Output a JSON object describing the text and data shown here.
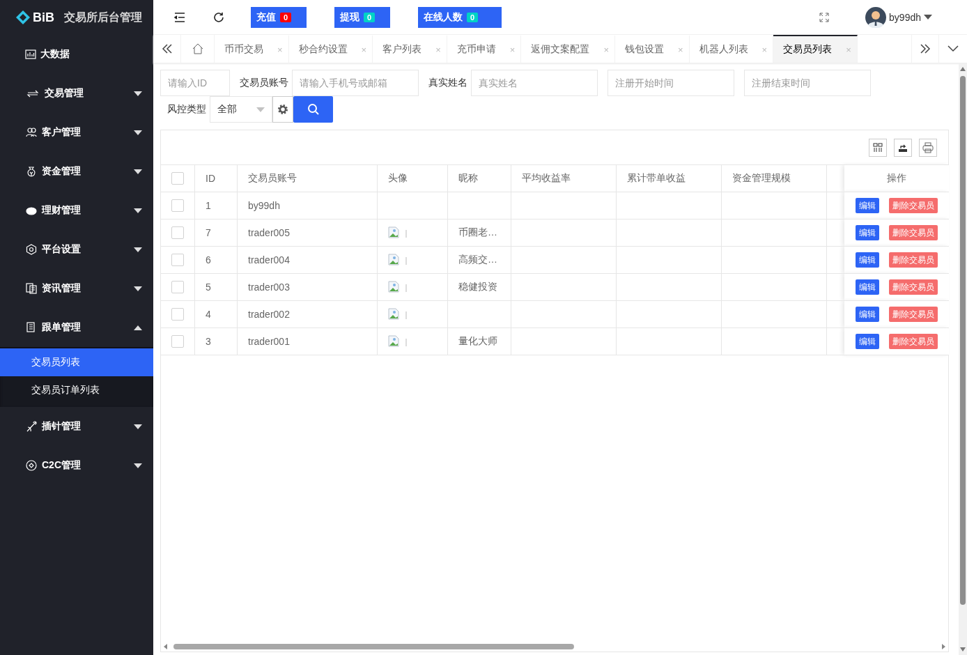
{
  "brand": {
    "logo": "BiB",
    "title": "交易所后台管理"
  },
  "topbar": {
    "badges": [
      {
        "label": "充值",
        "count": "0",
        "color": "#ff0000"
      },
      {
        "label": "提现",
        "count": "0",
        "color": "#00d2c6"
      },
      {
        "label": "在线人数",
        "count": "0",
        "color": "#00d2c6"
      }
    ],
    "user": "by99dh"
  },
  "sidebar": {
    "items": [
      {
        "label": "大数据",
        "kind": "link"
      },
      {
        "label": "交易管理",
        "kind": "group",
        "expanded": false
      },
      {
        "label": "客户管理",
        "kind": "group",
        "expanded": false
      },
      {
        "label": "资金管理",
        "kind": "group",
        "expanded": false
      },
      {
        "label": "理财管理",
        "kind": "group",
        "expanded": false
      },
      {
        "label": "平台设置",
        "kind": "group",
        "expanded": false
      },
      {
        "label": "资讯管理",
        "kind": "group",
        "expanded": false
      },
      {
        "label": "跟单管理",
        "kind": "group",
        "expanded": true,
        "children": [
          {
            "label": "交易员列表",
            "selected": true
          },
          {
            "label": "交易员订单列表",
            "selected": false
          }
        ]
      },
      {
        "label": "插针管理",
        "kind": "group",
        "expanded": false
      },
      {
        "label": "C2C管理",
        "kind": "group",
        "expanded": false
      }
    ]
  },
  "tabs": [
    {
      "label": "币币交易",
      "close": "×",
      "selected": false
    },
    {
      "label": "秒合约设置",
      "close": "×",
      "selected": false
    },
    {
      "label": "客户列表",
      "close": "×",
      "selected": false
    },
    {
      "label": "充币申请",
      "close": "×",
      "selected": false
    },
    {
      "label": "返佣文案配置",
      "close": "×",
      "selected": false
    },
    {
      "label": "钱包设置",
      "close": "×",
      "selected": false
    },
    {
      "label": "机器人列表",
      "close": "×",
      "selected": false
    },
    {
      "label": "交易员列表",
      "close": "×",
      "selected": true
    }
  ],
  "filters": {
    "id": {
      "placeholder": "请输入ID"
    },
    "account": {
      "label": "交易员账号",
      "placeholder": "请输入手机号或邮箱"
    },
    "real_name": {
      "label": "真实姓名",
      "placeholder": "真实姓名"
    },
    "start": {
      "placeholder": "注册开始时间"
    },
    "end": {
      "placeholder": "注册结束时间"
    },
    "risk": {
      "label": "风控类型",
      "value": "全部"
    }
  },
  "table": {
    "all_checked": false,
    "columns": [
      "ID",
      "交易员账号",
      "头像",
      "昵称",
      "平均收益率",
      "累计带单收益",
      "资金管理规模",
      "操作"
    ],
    "rows": [
      {
        "checked": false,
        "id": "1",
        "account": "by99dh",
        "avatar": false,
        "actions": [
          "编辑",
          "删除交易员"
        ]
      },
      {
        "checked": false,
        "id": "7",
        "account": "trader005",
        "avatar": true,
        "nickname": "币圈老…",
        "actions": [
          "编辑",
          "删除交易员"
        ]
      },
      {
        "checked": false,
        "id": "6",
        "account": "trader004",
        "avatar": true,
        "nickname": "高频交…",
        "actions": [
          "编辑",
          "删除交易员"
        ]
      },
      {
        "checked": false,
        "id": "5",
        "account": "trader003",
        "avatar": true,
        "nickname": "稳健投资",
        "actions": [
          "编辑",
          "删除交易员"
        ]
      },
      {
        "checked": false,
        "id": "4",
        "account": "trader002",
        "avatar": true,
        "actions": [
          "编辑",
          "删除交易员"
        ]
      },
      {
        "checked": false,
        "id": "3",
        "account": "trader001",
        "avatar": true,
        "nickname": "量化大师",
        "actions": [
          "编辑",
          "删除交易员"
        ]
      }
    ]
  }
}
